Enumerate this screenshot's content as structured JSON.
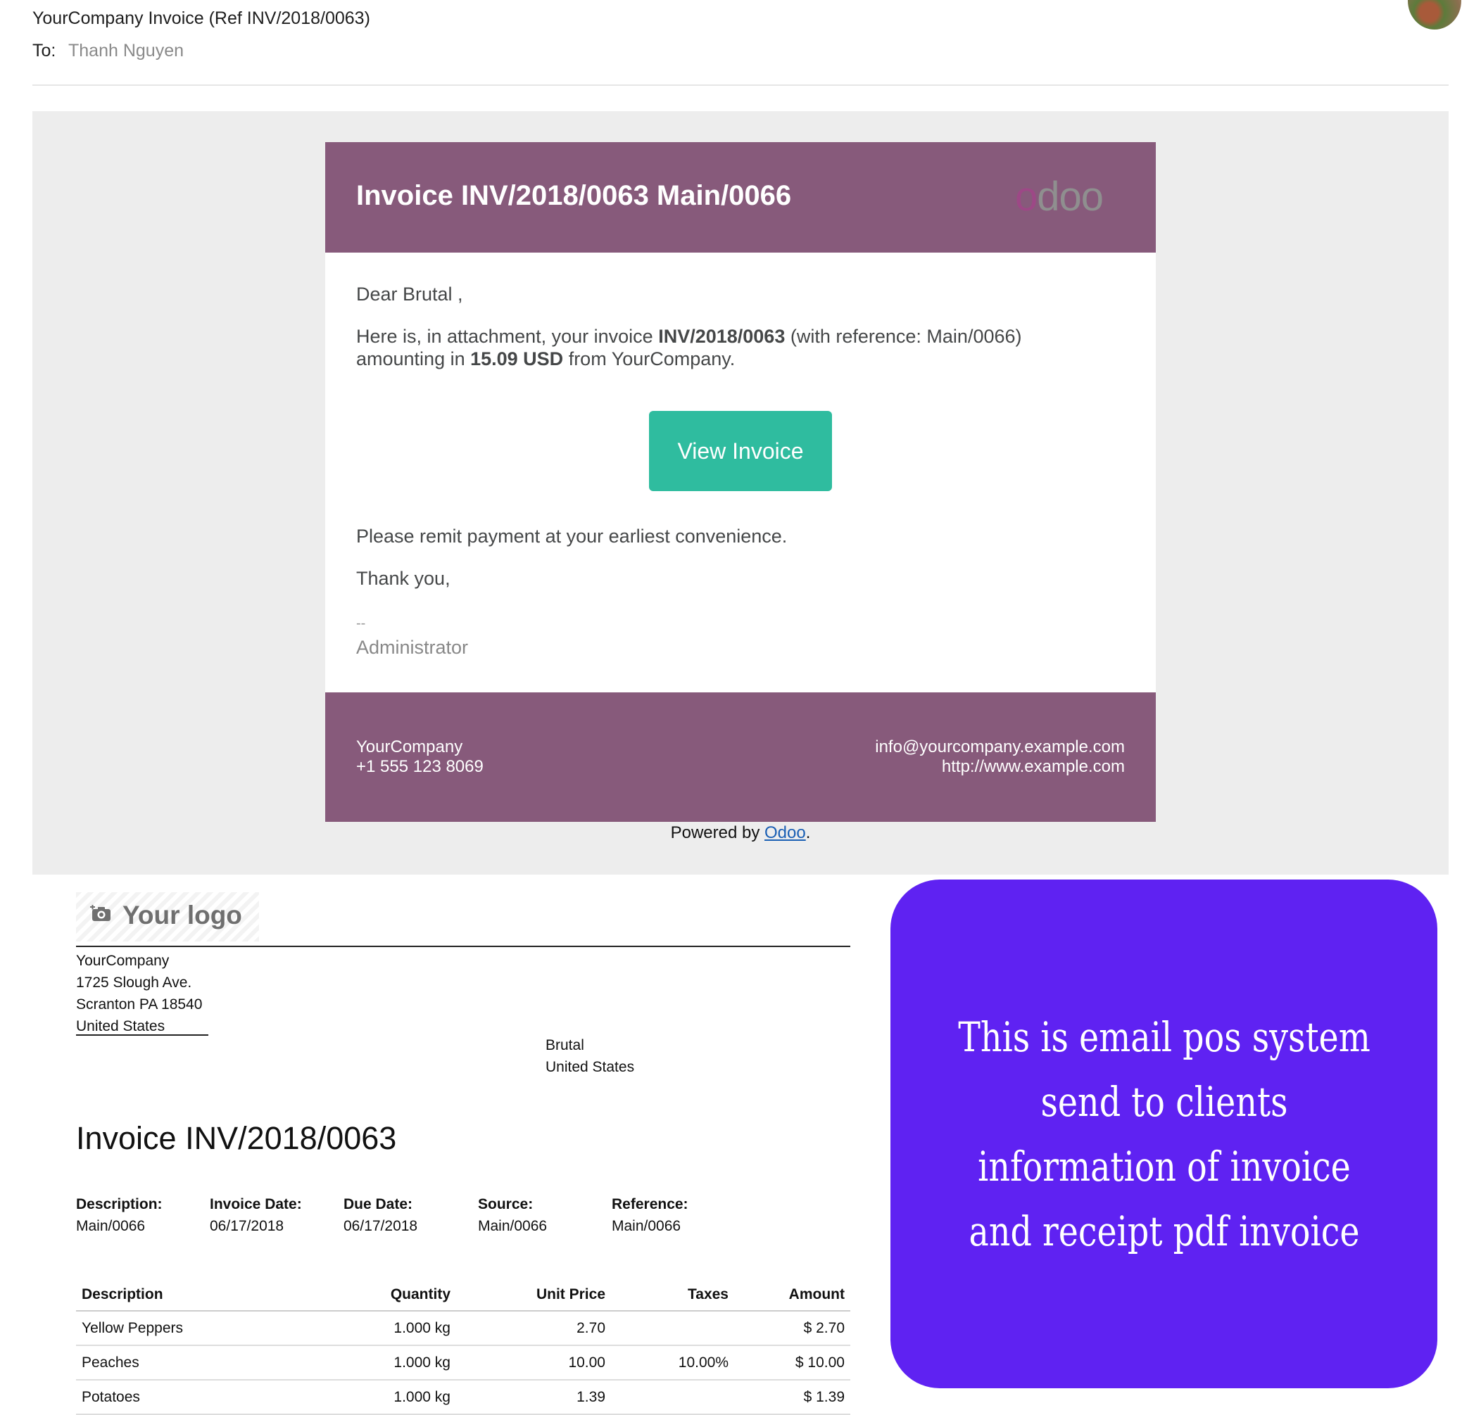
{
  "email": {
    "subject": "YourCompany Invoice (Ref INV/2018/0063)",
    "to_label": "To:",
    "to_value": "Thanh Nguyen"
  },
  "message": {
    "header_title": "Invoice INV/2018/0063 Main/0066",
    "logo_text_o": "o",
    "logo_text_rest": "doo",
    "greeting": "Dear Brutal ,",
    "line1_a": "Here is, in attachment, your invoice ",
    "line1_b": "INV/2018/0063",
    "line1_c": " (with reference: Main/0066)",
    "line2_a": "amounting in ",
    "line2_b": "15.09 USD",
    "line2_c": " from YourCompany.",
    "button_label": "View Invoice",
    "remit": "Please remit payment at your earliest convenience.",
    "thanks": "Thank you,",
    "dash": "--",
    "signature": "Administrator",
    "footer_company": "YourCompany",
    "footer_phone": "+1 555 123 8069",
    "footer_email": "info@yourcompany.example.com",
    "footer_web": "http://www.example.com",
    "powered_prefix": "Powered by ",
    "powered_link": "Odoo",
    "powered_suffix": "."
  },
  "invoice": {
    "logo_text": "Your logo",
    "company_lines": [
      "YourCompany",
      "1725 Slough Ave.",
      "Scranton PA 18540",
      "United States"
    ],
    "customer_lines": [
      "Brutal",
      "United States"
    ],
    "title": "Invoice INV/2018/0063",
    "meta": [
      {
        "label": "Description:",
        "value": "Main/0066"
      },
      {
        "label": "Invoice Date:",
        "value": "06/17/2018"
      },
      {
        "label": "Due Date:",
        "value": "06/17/2018"
      },
      {
        "label": "Source:",
        "value": "Main/0066"
      },
      {
        "label": "Reference:",
        "value": "Main/0066"
      }
    ],
    "columns": [
      "Description",
      "Quantity",
      "Unit Price",
      "Taxes",
      "Amount"
    ],
    "rows": [
      [
        "Yellow Peppers",
        "1.000 kg",
        "2.70",
        "",
        "$ 2.70"
      ],
      [
        "Peaches",
        "1.000 kg",
        "10.00",
        "10.00%",
        "$ 10.00"
      ],
      [
        "Potatoes",
        "1.000 kg",
        "1.39",
        "",
        "$ 1.39"
      ]
    ]
  },
  "promo": {
    "text": "This is email pos system send to clients information of invoice and receipt pdf invoice"
  },
  "colors": {
    "brand_purple": "#875a7b",
    "button_teal": "#2fbc9f",
    "promo_violet": "#5f22f2"
  },
  "icons": [
    "camera-plus-icon",
    "avatar"
  ]
}
